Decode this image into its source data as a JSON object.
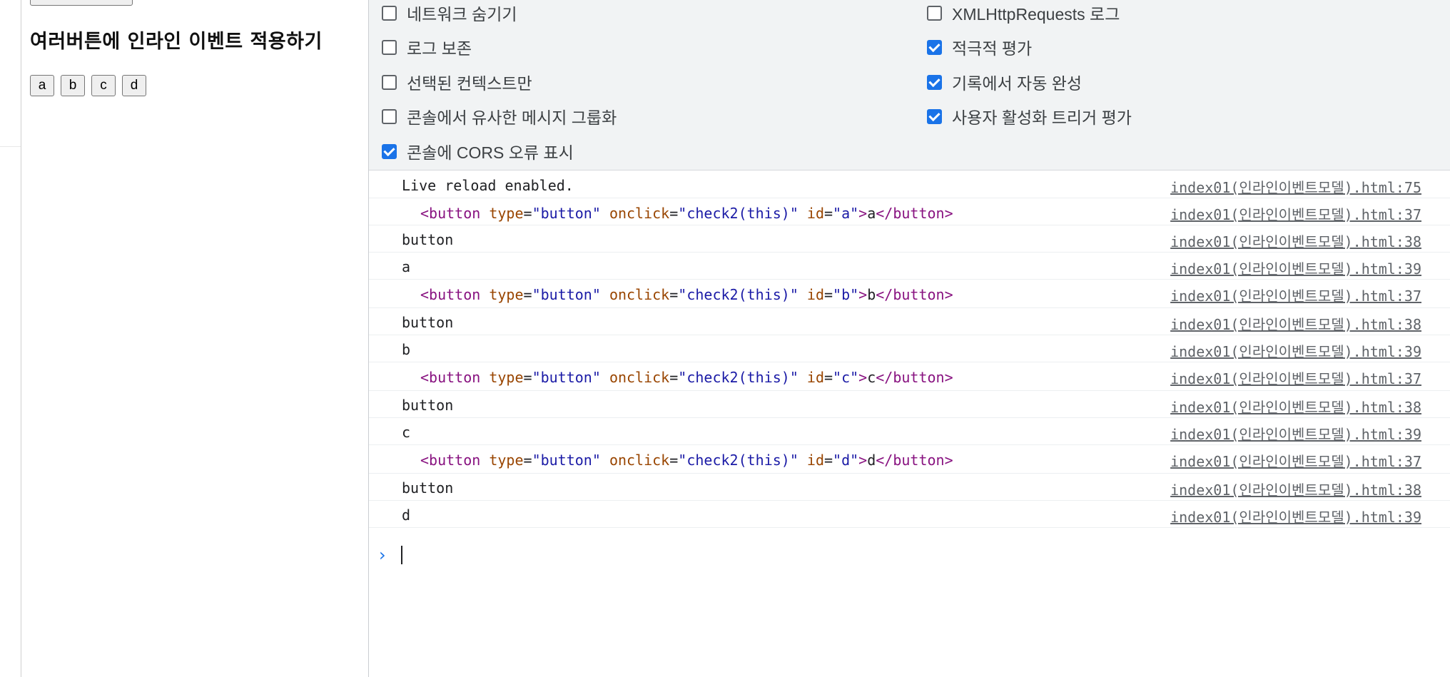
{
  "page": {
    "heading": "여러버튼에 인라인 이벤트 적용하기",
    "buttons": [
      "a",
      "b",
      "c",
      "d"
    ]
  },
  "settings": {
    "left": [
      {
        "label": "네트워크 숨기기",
        "checked": false
      },
      {
        "label": "로그 보존",
        "checked": false
      },
      {
        "label": "선택된 컨텍스트만",
        "checked": false
      },
      {
        "label": "콘솔에서 유사한 메시지 그룹화",
        "checked": false
      },
      {
        "label": "콘솔에 CORS 오류 표시",
        "checked": true
      }
    ],
    "right": [
      {
        "label": "XMLHttpRequests 로그",
        "checked": false
      },
      {
        "label": "적극적 평가",
        "checked": true
      },
      {
        "label": "기록에서 자동 완성",
        "checked": true
      },
      {
        "label": "사용자 활성화 트리거 평가",
        "checked": true
      }
    ]
  },
  "console": {
    "markup": {
      "open": "<button",
      "type_attr": "type",
      "type_val": "\"button\"",
      "onclick_attr": "onclick",
      "onclick_val": "\"check2(this)\"",
      "id_attr": "id",
      "close_tag": "</button>"
    },
    "entries": [
      {
        "kind": "text",
        "text": "Live reload enabled.",
        "source": "index01(인라인이벤트모델).html:75"
      },
      {
        "kind": "element",
        "id": "\"a\"",
        "content": "a",
        "source": "index01(인라인이벤트모델).html:37"
      },
      {
        "kind": "text",
        "text": "button",
        "source": "index01(인라인이벤트모델).html:38"
      },
      {
        "kind": "text",
        "text": "a",
        "source": "index01(인라인이벤트모델).html:39"
      },
      {
        "kind": "element",
        "id": "\"b\"",
        "content": "b",
        "source": "index01(인라인이벤트모델).html:37"
      },
      {
        "kind": "text",
        "text": "button",
        "source": "index01(인라인이벤트모델).html:38"
      },
      {
        "kind": "text",
        "text": "b",
        "source": "index01(인라인이벤트모델).html:39"
      },
      {
        "kind": "element",
        "id": "\"c\"",
        "content": "c",
        "source": "index01(인라인이벤트모델).html:37"
      },
      {
        "kind": "text",
        "text": "button",
        "source": "index01(인라인이벤트모델).html:38"
      },
      {
        "kind": "text",
        "text": "c",
        "source": "index01(인라인이벤트모델).html:39"
      },
      {
        "kind": "element",
        "id": "\"d\"",
        "content": "d",
        "source": "index01(인라인이벤트모델).html:37"
      },
      {
        "kind": "text",
        "text": "button",
        "source": "index01(인라인이벤트모델).html:38"
      },
      {
        "kind": "text",
        "text": "d",
        "source": "index01(인라인이벤트모델).html:39"
      }
    ],
    "prompt_icon": "chevron-right-icon"
  }
}
